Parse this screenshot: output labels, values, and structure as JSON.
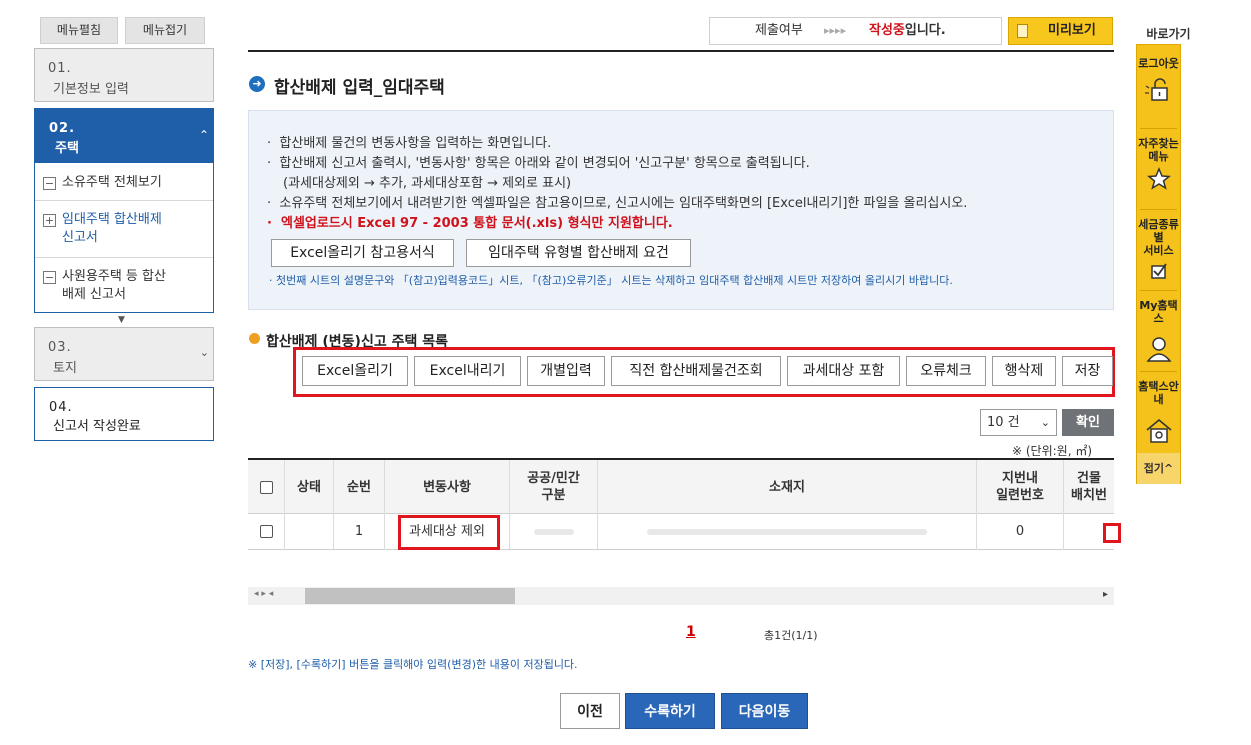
{
  "sidebar": {
    "expand_label": "메뉴펼침",
    "collapse_label": "메뉴접기",
    "steps": [
      {
        "num": "01.",
        "name": "기본정보 입력"
      },
      {
        "num": "02.",
        "name": "주택"
      },
      {
        "num": "03.",
        "name": "토지"
      },
      {
        "num": "04.",
        "name": "신고서 작성완료"
      }
    ],
    "sub_items": [
      {
        "label": "소유주택 전체보기"
      },
      {
        "label": "임대주택 합산배제",
        "label2": "신고서"
      },
      {
        "label": "사원용주택 등 합산",
        "label2": "배제 신고서"
      }
    ]
  },
  "status": {
    "label": "제출여부",
    "arrows": "▸▸▸▸",
    "value_red": "작성중",
    "value_suffix": "입니다.",
    "preview_label": "미리보기"
  },
  "quick": {
    "title": "바로가기",
    "items": [
      {
        "line1": "로그아웃",
        "line2": ""
      },
      {
        "line1": "자주찾는",
        "line2": "메뉴"
      },
      {
        "line1": "세금종류별",
        "line2": "서비스"
      },
      {
        "line1": "My홈택스",
        "line2": ""
      },
      {
        "line1": "홈택스안내",
        "line2": ""
      }
    ],
    "close_label": "접기^"
  },
  "main": {
    "title": "합산배제 입력_임대주택",
    "info": [
      "합산배제 물건의 변동사항을 입력하는 화면입니다.",
      "합산배제 신고서 출력시, '변동사항' 항목은 아래와 같이 변경되어 '신고구분' 항목으로 출력됩니다.",
      "(과세대상제외 → 추가, 과세대상포함 → 제외로 표시)",
      "소유주택 전체보기에서 내려받기한 엑셀파일은 참고용이므로, 신고시에는 임대주택화면의 [Excel내리기]한 파일을 올리십시오.",
      "엑셀업로드시 Excel 97 - 2003 통합 문서(.xls) 형식만 지원합니다."
    ],
    "info_btn1": "Excel올리기 참고용서식",
    "info_btn2": "임대주택 유형별 합산배제 요건",
    "info_note": "첫번째 시트의 설명문구와 「(참고)입력용코드」시트, 「(참고)오류기준」 시트는 삭제하고 임대주택 합산배제 시트만 저장하여 올리시기 바랍니다.",
    "section_title": "합산배제 (변동)신고 주택 목록",
    "toolbar": [
      "Excel올리기",
      "Excel내리기",
      "개별입력",
      "직전 합산배제물건조회",
      "과세대상 포함",
      "오류체크",
      "행삭제",
      "저장"
    ],
    "page_size": "10 건",
    "confirm_label": "확인",
    "unit": "※ (단위:원, ㎡)"
  },
  "table": {
    "headers": {
      "status": "상태",
      "seq": "순번",
      "change": "변동사항",
      "pub1": "공공/민간",
      "pub2": "구분",
      "addr": "소재지",
      "serial1": "지번내",
      "serial2": "일련번호",
      "bld1": "건물",
      "bld2": "배치번"
    },
    "rows": [
      {
        "status": "",
        "seq": "1",
        "change": "과세대상 제외",
        "serial": "0"
      }
    ]
  },
  "pager": {
    "current": "1",
    "total": "총1건(1/1)"
  },
  "note": "※ [저장], [수록하기] 버튼을 클릭해야 입력(변경)한 내용이 저장됩니다.",
  "bottom": {
    "prev": "이전",
    "submit": "수록하기",
    "next": "다음이동"
  },
  "colors": {
    "primary": "#1f5ea8",
    "highlight": "#e0161e",
    "quick_bar": "#f5c21b"
  }
}
